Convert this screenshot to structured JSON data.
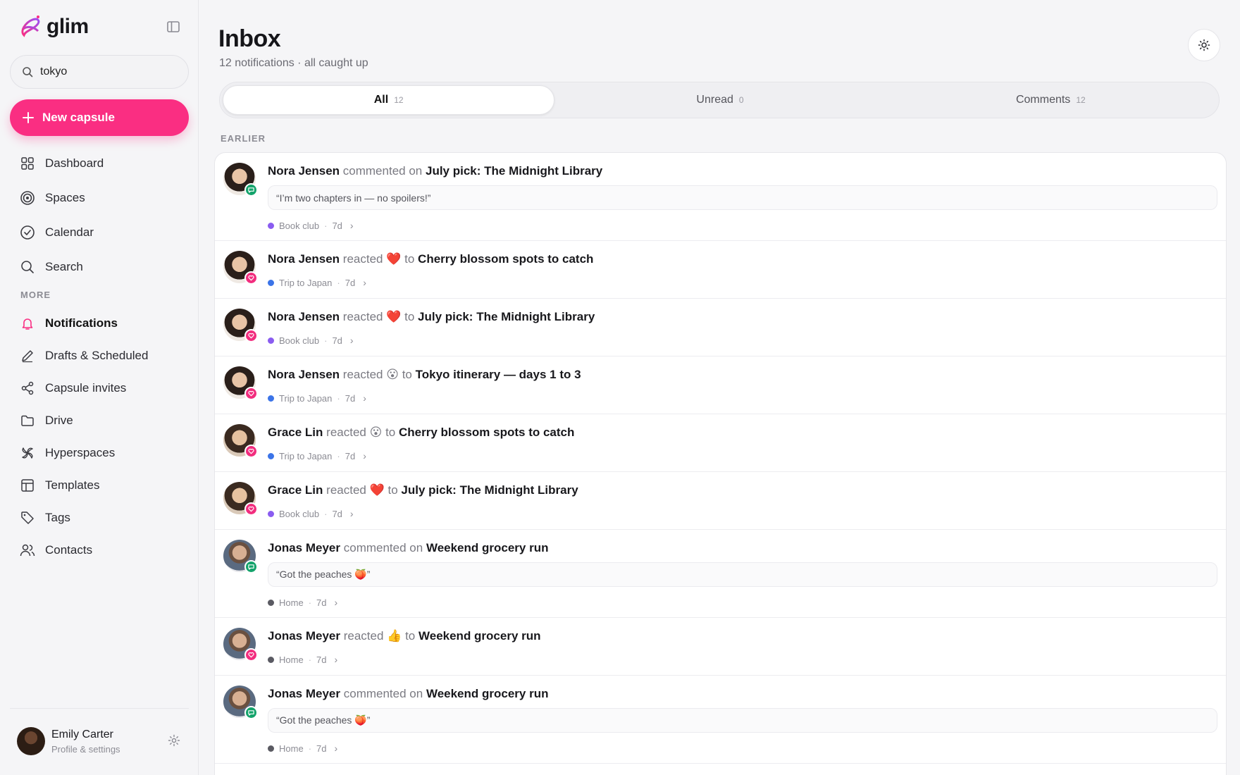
{
  "sidebar": {
    "logo_text": "glim",
    "search_value": "tokyo",
    "new_button_label": "New capsule",
    "primary_nav": [
      {
        "label": "Dashboard",
        "icon": "grid-icon"
      },
      {
        "label": "Spaces",
        "icon": "target-icon"
      },
      {
        "label": "Calendar",
        "icon": "check-circle-icon"
      },
      {
        "label": "Search",
        "icon": "search-icon"
      }
    ],
    "more_label": "MORE",
    "more_nav": [
      {
        "label": "Notifications",
        "icon": "bell-icon",
        "active": true
      },
      {
        "label": "Drafts & Scheduled",
        "icon": "pen-icon"
      },
      {
        "label": "Capsule invites",
        "icon": "share-icon"
      },
      {
        "label": "Drive",
        "icon": "folder-icon"
      },
      {
        "label": "Hyperspaces",
        "icon": "pinwheel-icon"
      },
      {
        "label": "Templates",
        "icon": "layout-icon"
      },
      {
        "label": "Tags",
        "icon": "tag-icon"
      },
      {
        "label": "Contacts",
        "icon": "users-icon"
      }
    ],
    "profile": {
      "name": "Emily Carter",
      "subtitle": "Profile & settings"
    }
  },
  "header": {
    "title": "Inbox",
    "subtitle": "12 notifications · all caught up"
  },
  "tabs": [
    {
      "label": "All",
      "count": "12",
      "active": true
    },
    {
      "label": "Unread",
      "count": "0"
    },
    {
      "label": "Comments",
      "count": "12"
    }
  ],
  "section_label": "EARLIER",
  "colors": {
    "accent": "#fa2e82",
    "book_club": "#8a5cf0",
    "trip_to_japan": "#3b74e8",
    "home": "#5a5a62",
    "comment_badge": "#14a36b",
    "reaction_badge": "#f22d7e"
  },
  "notifications": [
    {
      "actor": "Nora Jensen",
      "verb": "commented",
      "connector": "on",
      "emoji": "",
      "target": "July pick: The Midnight Library",
      "quote": "“I’m two chapters in — no spoilers!”",
      "space": "Book club",
      "time": "7d"
    },
    {
      "actor": "Nora Jensen",
      "verb": "reacted",
      "connector": "to",
      "emoji": "❤️",
      "target": "Cherry blossom spots to catch",
      "quote": "",
      "space": "Trip to Japan",
      "time": "7d"
    },
    {
      "actor": "Nora Jensen",
      "verb": "reacted",
      "connector": "to",
      "emoji": "❤️",
      "target": "July pick: The Midnight Library",
      "quote": "",
      "space": "Book club",
      "time": "7d"
    },
    {
      "actor": "Nora Jensen",
      "verb": "reacted",
      "connector": "to",
      "emoji": "😮",
      "target": "Tokyo itinerary — days 1 to 3",
      "quote": "",
      "space": "Trip to Japan",
      "time": "7d"
    },
    {
      "actor": "Grace Lin",
      "verb": "reacted",
      "connector": "to",
      "emoji": "😮",
      "target": "Cherry blossom spots to catch",
      "quote": "",
      "space": "Trip to Japan",
      "time": "7d"
    },
    {
      "actor": "Grace Lin",
      "verb": "reacted",
      "connector": "to",
      "emoji": "❤️",
      "target": "July pick: The Midnight Library",
      "quote": "",
      "space": "Book club",
      "time": "7d"
    },
    {
      "actor": "Jonas Meyer",
      "verb": "commented",
      "connector": "on",
      "emoji": "",
      "target": "Weekend grocery run",
      "quote": "“Got the peaches 🍑”",
      "space": "Home",
      "time": "7d"
    },
    {
      "actor": "Jonas Meyer",
      "verb": "reacted",
      "connector": "to",
      "emoji": "👍",
      "target": "Weekend grocery run",
      "quote": "",
      "space": "Home",
      "time": "7d"
    },
    {
      "actor": "Jonas Meyer",
      "verb": "commented",
      "connector": "on",
      "emoji": "",
      "target": "Weekend grocery run",
      "quote": "“Got the peaches 🍑”",
      "space": "Home",
      "time": "7d"
    }
  ]
}
